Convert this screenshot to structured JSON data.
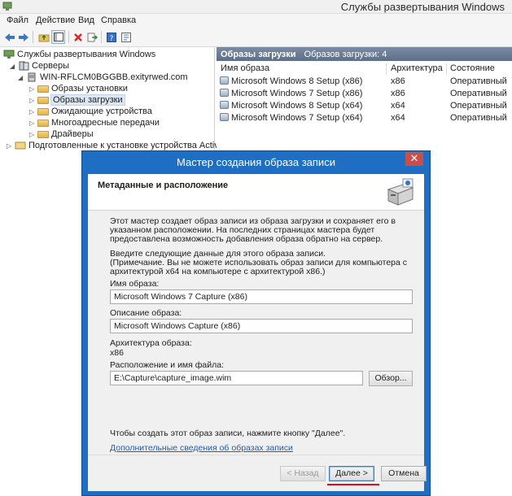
{
  "window": {
    "title": "Службы развертывания Windows"
  },
  "menu": [
    "Файл",
    "Действие",
    "Вид",
    "Справка"
  ],
  "toolbar": {
    "icons": [
      "back-arrow-icon",
      "forward-arrow-icon",
      "up-folder-icon",
      "show-hide-tree-icon",
      "delete-icon",
      "export-icon",
      "help-icon",
      "properties-icon"
    ]
  },
  "tree": {
    "root": "Службы развертывания Windows",
    "servers": "Серверы",
    "server": "WIN-RFLCM0BGGBB.exityrwed.com",
    "items": [
      "Образы установки",
      "Образы загрузки",
      "Ожидающие устройства",
      "Многоадресные передачи",
      "Драйверы"
    ],
    "selected_index": 1,
    "prestaged": "Подготовленные к установке устройства Active Direc"
  },
  "right_pane": {
    "header_title": "Образы загрузки",
    "header_count": "Образов загрузки: 4",
    "columns": [
      "Имя образа",
      "Архитектура",
      "Состояние"
    ],
    "rows": [
      {
        "name": "Microsoft Windows 8 Setup (x86)",
        "arch": "x86",
        "state": "Оперативный"
      },
      {
        "name": "Microsoft Windows 7 Setup (x86)",
        "arch": "x86",
        "state": "Оперативный"
      },
      {
        "name": "Microsoft Windows 8 Setup (x64)",
        "arch": "x64",
        "state": "Оперативный"
      },
      {
        "name": "Microsoft Windows 7 Setup (x64)",
        "arch": "x64",
        "state": "Оперативный"
      }
    ]
  },
  "dialog": {
    "title": "Мастер создания образа записи",
    "close": "✕",
    "section_title": "Метаданные и расположение",
    "intro": "Этот мастер создает образ записи из образа загрузки и сохраняет его в указанном расположении. На последних страницах мастера будет предоставлена возможность добавления образа обратно на сервер.",
    "instructions": "Введите следующие данные для этого образа записи.\n(Примечание. Вы не можете использовать образ записи для компьютера с архитектурой x64 на компьютере с архитектурой x86.)",
    "image_name_label": "Имя образа:",
    "image_name_value": "Microsoft Windows 7 Capture (x86)",
    "image_desc_label": "Описание образа:",
    "image_desc_value": "Microsoft Windows Capture (x86)",
    "arch_label": "Архитектура образа:",
    "arch_value": "x86",
    "path_label": "Расположение и имя файла:",
    "path_value": "E:\\Capture\\capture_image.wim",
    "browse_button": "Обзор...",
    "hint": "Чтобы создать этот образ записи, нажмите кнопку \"Далее\".",
    "link": "Дополнительные сведения об образах записи",
    "back_button": "< Назад",
    "next_button": "Далее >",
    "cancel_button": "Отмена"
  },
  "colors": {
    "dialog_frame": "#1e6fc4",
    "close_button": "#c7504b",
    "list_header": "#6a7a93",
    "annotation": "#d10d1f"
  }
}
